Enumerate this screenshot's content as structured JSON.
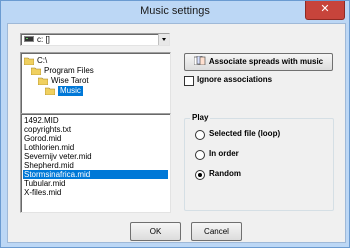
{
  "window": {
    "title": "Music settings",
    "close_glyph": "✕"
  },
  "drive": {
    "value": "c: []",
    "icon": "drive-icon"
  },
  "directories": [
    {
      "label": "C:\\",
      "icon": "open-folder-icon",
      "selected": false
    },
    {
      "label": "Program Files",
      "icon": "open-folder-icon",
      "selected": false
    },
    {
      "label": "Wise Tarot",
      "icon": "open-folder-icon",
      "selected": false
    },
    {
      "label": "Music",
      "icon": "open-folder-icon",
      "selected": true
    }
  ],
  "files": [
    {
      "label": "1492.MID",
      "selected": false
    },
    {
      "label": "copyrights.txt",
      "selected": false
    },
    {
      "label": "Gorod.mid",
      "selected": false
    },
    {
      "label": "Lothlorien.mid",
      "selected": false
    },
    {
      "label": "Severnijv veter.mid",
      "selected": false
    },
    {
      "label": "Shepherd.mid",
      "selected": false
    },
    {
      "label": "Stormsinafrica.mid",
      "selected": true
    },
    {
      "label": "Tubular.mid",
      "selected": false
    },
    {
      "label": "X-files.mid",
      "selected": false
    }
  ],
  "associate_button": {
    "label": "Associate spreads with music",
    "icon": "cards-icon"
  },
  "ignore_associations": {
    "label": "Ignore associations",
    "checked": false
  },
  "play_group": {
    "legend": "Play",
    "options": [
      {
        "label": "Selected file (loop)",
        "checked": false
      },
      {
        "label": "In order",
        "checked": false
      },
      {
        "label": "Random",
        "checked": true
      }
    ]
  },
  "buttons": {
    "ok": "OK",
    "cancel": "Cancel"
  },
  "colors": {
    "selection": "#0078d7",
    "frame": "#bcd7f5",
    "close": "#c7443b"
  }
}
